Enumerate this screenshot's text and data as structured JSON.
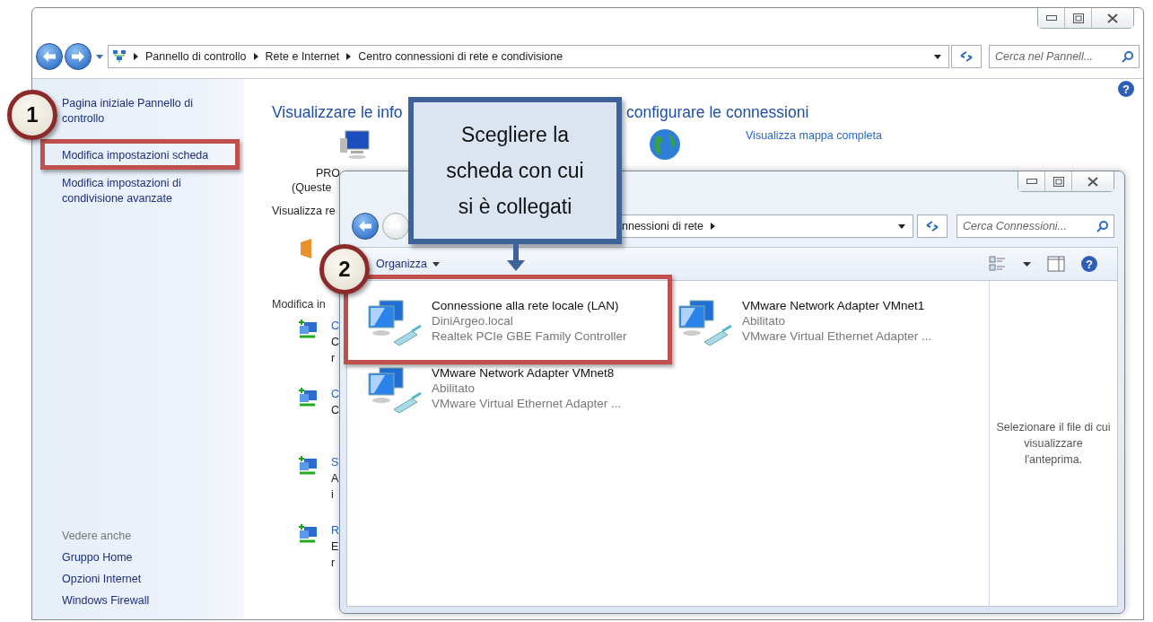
{
  "main_window": {
    "address_bar": {
      "path": [
        "Pannello di controllo",
        "Rete e Internet",
        "Centro connessioni di rete e condivisione"
      ]
    },
    "search": {
      "placeholder": "Cerca nel Pannell..."
    },
    "help": "?",
    "sidebar": {
      "links": [
        "Pagina iniziale Pannello di controllo",
        "Modifica impostazioni scheda",
        "Modifica impostazioni di condivisione avanzate"
      ],
      "see_also": {
        "heading": "Vedere anche",
        "links": [
          "Gruppo Home",
          "Opzioni Internet",
          "Windows Firewall"
        ]
      }
    },
    "heading": [
      "Visualizzare le info",
      "configurare le connessioni"
    ],
    "map_link": "Visualizza mappa completa",
    "computer_label": [
      "PRO",
      "(Queste"
    ],
    "section_label": "Visualizza re",
    "tasks_heading": "Modifica in",
    "tasks": [
      {
        "title": "C",
        "lines": [
          "C",
          "r"
        ]
      },
      {
        "title": "C",
        "lines": [
          "C"
        ]
      },
      {
        "title": "S",
        "lines": [
          "A",
          "i"
        ]
      },
      {
        "title": "R",
        "lines": [
          "E",
          "r"
        ]
      }
    ]
  },
  "inner_window": {
    "address_bar": {
      "path": [
        "nnessioni di rete"
      ]
    },
    "search": {
      "placeholder": "Cerca Connessioni..."
    },
    "toolbar": {
      "organize": "Organizza",
      "help": "?"
    },
    "connections": [
      {
        "name": "Connessione alla rete locale (LAN)",
        "status": "DiniArgeo.local",
        "adapter": "Realtek PCIe GBE Family Controller"
      },
      {
        "name": "VMware Network Adapter VMnet1",
        "status": "Abilitato",
        "adapter": "VMware Virtual Ethernet Adapter ..."
      },
      {
        "name": "VMware Network Adapter VMnet8",
        "status": "Abilitato",
        "adapter": "VMware Virtual Ethernet Adapter ..."
      }
    ],
    "preview_text": "Selezionare il file di cui visualizzare l'anteprima."
  },
  "annotations": {
    "callout": [
      "Scegliere la",
      "scheda con cui",
      "si è collegati"
    ],
    "steps": [
      "1",
      "2"
    ]
  }
}
